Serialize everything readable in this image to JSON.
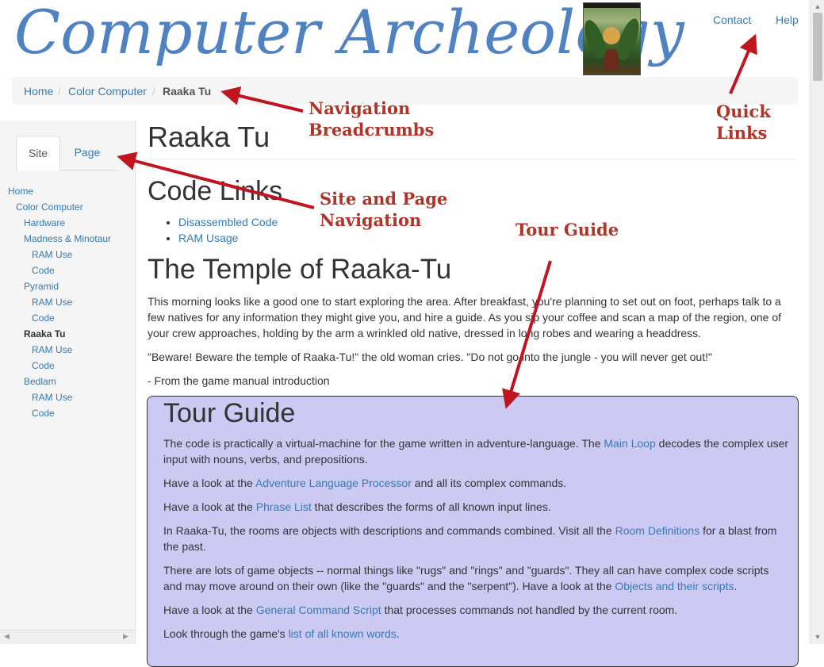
{
  "header": {
    "logo_text": "Computer Archeology",
    "cover_image_label": "game-cover-image",
    "links": [
      "Contact",
      "Help"
    ]
  },
  "breadcrumb": {
    "items": [
      "Home",
      "Color Computer"
    ],
    "active": "Raaka Tu",
    "separator": "/"
  },
  "sidebar": {
    "tabs": [
      "Site",
      "Page"
    ],
    "tree": [
      {
        "label": "Home",
        "level": 0,
        "current": false
      },
      {
        "label": "Color Computer",
        "level": 1,
        "current": false
      },
      {
        "label": "Hardware",
        "level": 2,
        "current": false
      },
      {
        "label": "Madness & Minotaur",
        "level": 2,
        "current": false
      },
      {
        "label": "RAM Use",
        "level": 3,
        "current": false
      },
      {
        "label": "Code",
        "level": 3,
        "current": false
      },
      {
        "label": "Pyramid",
        "level": 2,
        "current": false
      },
      {
        "label": "RAM Use",
        "level": 3,
        "current": false
      },
      {
        "label": "Code",
        "level": 3,
        "current": false
      },
      {
        "label": "Raaka Tu",
        "level": 2,
        "current": true
      },
      {
        "label": "RAM Use",
        "level": 3,
        "current": false
      },
      {
        "label": "Code",
        "level": 3,
        "current": false
      },
      {
        "label": "Bedlam",
        "level": 2,
        "current": false
      },
      {
        "label": "RAM Use",
        "level": 3,
        "current": false
      },
      {
        "label": "Code",
        "level": 3,
        "current": false
      }
    ]
  },
  "main": {
    "page_title": "Raaka Tu",
    "code_links_heading": "Code Links",
    "code_links": [
      "Disassembled Code",
      "RAM Usage"
    ],
    "temple_heading": "The Temple of Raaka-Tu",
    "intro": "This morning looks like a good one to start exploring the area. After breakfast, you're planning to set out on foot, perhaps talk to a few natives for any information they might give you, and hire a guide. As you sip your coffee and scan a map of the region, one of your crew approaches, holding by the arm a wrinkled old native, dressed in long robes and wearing a headdress.",
    "quote": "\"Beware! Beware the temple of Raaka-Tu!\" the old woman cries. \"Do not go into the jungle - you will never get out!\"",
    "source": "- From the game manual introduction"
  },
  "tour": {
    "heading": "Tour Guide",
    "p1": {
      "pre": "The code is practically a virtual-machine for the game written in adventure-language. The ",
      "link": "Main Loop",
      "post": " decodes the complex user input with nouns, verbs, and prepositions."
    },
    "p2": {
      "pre": "Have a look at the ",
      "link": "Adventure Language Processor",
      "post": " and all its complex commands."
    },
    "p3": {
      "pre": "Have a look at the ",
      "link": "Phrase List",
      "post": " that describes the forms of all known input lines."
    },
    "p4": {
      "pre": "In Raaka-Tu, the rooms are objects with descriptions and commands combined. Visit all the ",
      "link": "Room Definitions",
      "post": " for a blast from the past."
    },
    "p5": {
      "pre": "There are lots of game objects -- normal things like \"rugs\" and \"rings\" and \"guards\". They all can have complex code scripts and may move around on their own (like the \"guards\" and the \"serpent\"). Have a look at the ",
      "link": "Objects and their scripts",
      "post": "."
    },
    "p6": {
      "pre": "Have a look at the ",
      "link": "General Command Script",
      "post": " that processes commands not handled by the current room."
    },
    "p7": {
      "pre": "Look through the game's ",
      "link": "list of all known words",
      "post": "."
    }
  },
  "annotations": {
    "nav_breadcrumbs": [
      "Navigation",
      "Breadcrumbs"
    ],
    "quick_links": [
      "Quick",
      "Links"
    ],
    "site_page_nav": [
      "Site and Page",
      "Navigation"
    ],
    "tour_guide": "Tour Guide"
  },
  "colors": {
    "logo": "#4f82c2",
    "link": "#337ab7",
    "tour_background": "#cccaf3",
    "annotation": "#b03427"
  }
}
